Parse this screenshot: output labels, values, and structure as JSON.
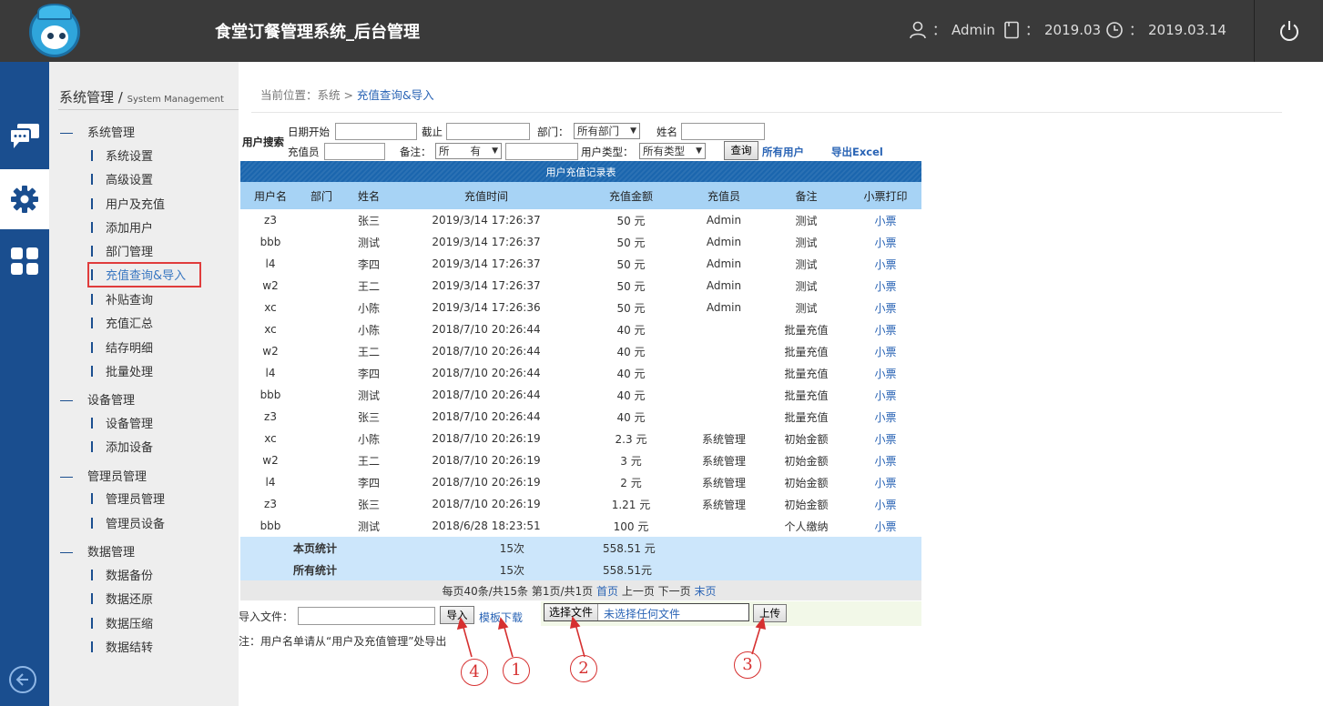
{
  "header": {
    "title": "食堂订餐管理系统_后台管理",
    "user": "Admin",
    "month": "2019.03",
    "date": "2019.03.14",
    "colon": "："
  },
  "rail": [
    "chat-icon",
    "gear-icon",
    "grid-icon",
    "back-icon"
  ],
  "sidebar": {
    "title": "系统管理 / ",
    "title_en": "System Management",
    "groups": [
      {
        "label": "系统管理",
        "items": [
          "系统设置",
          "高级设置",
          "用户及充值",
          "添加用户",
          "部门管理",
          "充值查询&导入",
          "补贴查询",
          "充值汇总",
          "结存明细",
          "批量处理"
        ]
      },
      {
        "label": "设备管理",
        "items": [
          "设备管理",
          "添加设备"
        ]
      },
      {
        "label": "管理员管理",
        "items": [
          "管理员管理",
          "管理员设备"
        ]
      },
      {
        "label": "数据管理",
        "items": [
          "数据备份",
          "数据还原",
          "数据压缩",
          "数据结转"
        ]
      }
    ],
    "active_item": "充值查询&导入"
  },
  "breadcrumb": {
    "prefix": "当前位置：系统 > ",
    "current": "充值查询&导入"
  },
  "search": {
    "title": "用户搜索",
    "date_start_label": "日期开始",
    "date_end_label": "截止",
    "dept_label": "部门：",
    "dept_value": "所有部门",
    "name_label": "姓名",
    "operator_label": "充值员",
    "note_label": "备注：",
    "note_value": "所　　有",
    "user_type_label": "用户类型：",
    "user_type_value": "所有类型",
    "query_button": "查询",
    "all_users_link": "所有用户",
    "export_link": "导出Excel"
  },
  "table": {
    "caption": "用户充值记录表",
    "columns": [
      "用户名",
      "部门",
      "姓名",
      "充值时间",
      "充值金额",
      "充值员",
      "备注",
      "小票打印"
    ],
    "rows": [
      [
        "z3",
        "",
        "张三",
        "2019/3/14 17:26:37",
        "50 元",
        "Admin",
        "测试",
        "小票"
      ],
      [
        "bbb",
        "",
        "测试",
        "2019/3/14 17:26:37",
        "50 元",
        "Admin",
        "测试",
        "小票"
      ],
      [
        "l4",
        "",
        "李四",
        "2019/3/14 17:26:37",
        "50 元",
        "Admin",
        "测试",
        "小票"
      ],
      [
        "w2",
        "",
        "王二",
        "2019/3/14 17:26:37",
        "50 元",
        "Admin",
        "测试",
        "小票"
      ],
      [
        "xc",
        "",
        "小陈",
        "2019/3/14 17:26:36",
        "50 元",
        "Admin",
        "测试",
        "小票"
      ],
      [
        "xc",
        "",
        "小陈",
        "2018/7/10 20:26:44",
        "40 元",
        "",
        "批量充值",
        "小票"
      ],
      [
        "w2",
        "",
        "王二",
        "2018/7/10 20:26:44",
        "40 元",
        "",
        "批量充值",
        "小票"
      ],
      [
        "l4",
        "",
        "李四",
        "2018/7/10 20:26:44",
        "40 元",
        "",
        "批量充值",
        "小票"
      ],
      [
        "bbb",
        "",
        "测试",
        "2018/7/10 20:26:44",
        "40 元",
        "",
        "批量充值",
        "小票"
      ],
      [
        "z3",
        "",
        "张三",
        "2018/7/10 20:26:44",
        "40 元",
        "",
        "批量充值",
        "小票"
      ],
      [
        "xc",
        "",
        "小陈",
        "2018/7/10 20:26:19",
        "2.3 元",
        "系统管理",
        "初始金额",
        "小票"
      ],
      [
        "w2",
        "",
        "王二",
        "2018/7/10 20:26:19",
        "3 元",
        "系统管理",
        "初始金额",
        "小票"
      ],
      [
        "l4",
        "",
        "李四",
        "2018/7/10 20:26:19",
        "2 元",
        "系统管理",
        "初始金额",
        "小票"
      ],
      [
        "z3",
        "",
        "张三",
        "2018/7/10 20:26:19",
        "1.21 元",
        "系统管理",
        "初始金额",
        "小票"
      ],
      [
        "bbb",
        "",
        "测试",
        "2018/6/28 18:23:51",
        "100 元",
        "",
        "个人缴纳",
        "小票"
      ]
    ],
    "summary": [
      {
        "label": "本页统计",
        "count": "15次",
        "amount": "558.51 元"
      },
      {
        "label": "所有统计",
        "count": "15次",
        "amount": "558.51元"
      }
    ],
    "pager": {
      "info": "每页40条/共15条 第1页/共1页 ",
      "first": "首页",
      "prev": "上一页",
      "next": "下一页",
      "last": "末页"
    }
  },
  "import": {
    "file_label": "导入文件：",
    "import_button": "导入",
    "template_link": "模板下载",
    "choose_button": "选择文件",
    "no_file_text": "未选择任何文件",
    "upload_button": "上传",
    "note": "注：用户名单请从“用户及充值管理”处导出"
  },
  "annotations": [
    "4",
    "1",
    "2",
    "3"
  ],
  "colors": {
    "header_bg": "#3a3a3a",
    "rail_bg": "#1a4e8f",
    "accent": "#2a64b5",
    "annotation": "#d63030"
  }
}
